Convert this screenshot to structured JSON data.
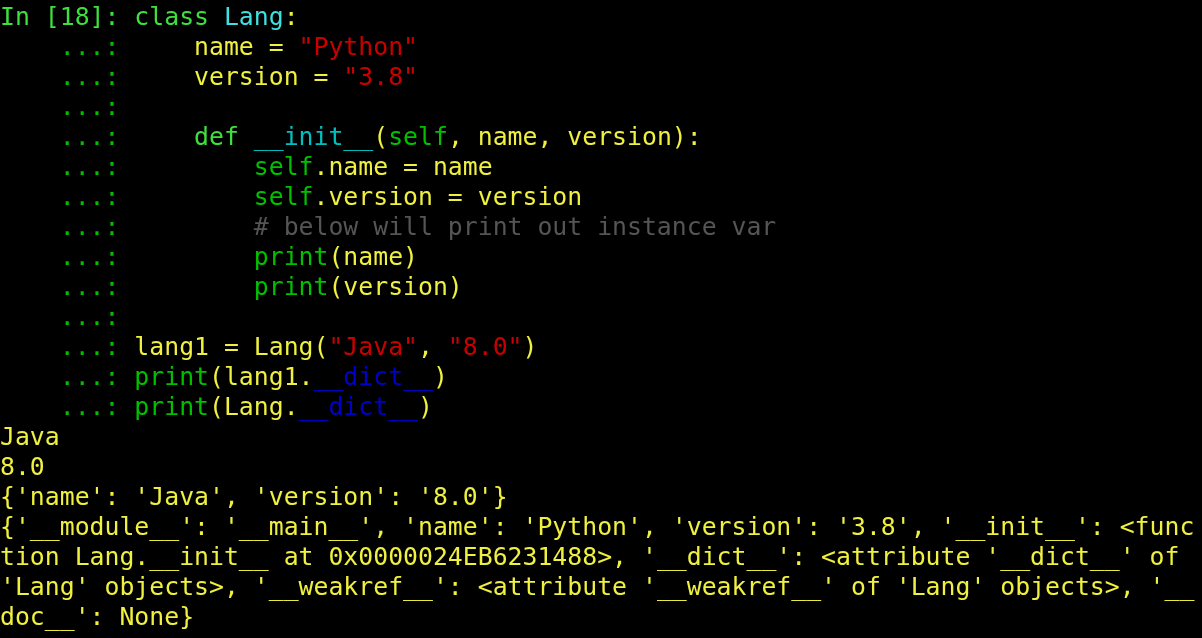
{
  "terminal": {
    "lines": [
      {
        "prompt": {
          "kind": "in",
          "text": "In [18]:"
        },
        "tokens": [
          {
            "kind": "keyword",
            "text": "class"
          },
          {
            "kind": "classname",
            "text": " Lang"
          },
          {
            "kind": "plain",
            "text": ":"
          }
        ]
      },
      {
        "prompt": {
          "kind": "cont",
          "text": "...:"
        },
        "tokens": [
          {
            "kind": "plain",
            "text": "    name = "
          },
          {
            "kind": "string",
            "text": "\"Python\""
          }
        ]
      },
      {
        "prompt": {
          "kind": "cont",
          "text": "...:"
        },
        "tokens": [
          {
            "kind": "plain",
            "text": "    version = "
          },
          {
            "kind": "string",
            "text": "\"3.8\""
          }
        ]
      },
      {
        "prompt": {
          "kind": "cont",
          "text": "...:"
        }
      },
      {
        "prompt": {
          "kind": "cont",
          "text": "...:"
        },
        "tokens": [
          {
            "kind": "keyword",
            "text": "    def"
          },
          {
            "kind": "function",
            "text": " __init__"
          },
          {
            "kind": "plain",
            "text": "("
          },
          {
            "kind": "builtin",
            "text": "self"
          },
          {
            "kind": "plain",
            "text": ", name, version):"
          }
        ]
      },
      {
        "prompt": {
          "kind": "cont",
          "text": "...:"
        },
        "tokens": [
          {
            "kind": "builtin",
            "text": "        self"
          },
          {
            "kind": "plain",
            "text": ".name = name"
          }
        ]
      },
      {
        "prompt": {
          "kind": "cont",
          "text": "...:"
        },
        "tokens": [
          {
            "kind": "builtin",
            "text": "        self"
          },
          {
            "kind": "plain",
            "text": ".version = version"
          }
        ]
      },
      {
        "prompt": {
          "kind": "cont",
          "text": "...:"
        },
        "tokens": [
          {
            "kind": "comment",
            "text": "        # below will print out instance var"
          }
        ]
      },
      {
        "prompt": {
          "kind": "cont",
          "text": "...:"
        },
        "tokens": [
          {
            "kind": "builtin",
            "text": "        print"
          },
          {
            "kind": "plain",
            "text": "(name)"
          }
        ]
      },
      {
        "prompt": {
          "kind": "cont",
          "text": "...:"
        },
        "tokens": [
          {
            "kind": "builtin",
            "text": "        print"
          },
          {
            "kind": "plain",
            "text": "(version)"
          }
        ]
      },
      {
        "prompt": {
          "kind": "cont",
          "text": "...:"
        }
      },
      {
        "prompt": {
          "kind": "cont",
          "text": "...:"
        },
        "tokens": [
          {
            "kind": "plain",
            "text": "lang1 = Lang("
          },
          {
            "kind": "string",
            "text": "\"Java\""
          },
          {
            "kind": "plain",
            "text": ", "
          },
          {
            "kind": "string",
            "text": "\"8.0\""
          },
          {
            "kind": "plain",
            "text": ")"
          }
        ]
      },
      {
        "prompt": {
          "kind": "cont",
          "text": "...:"
        },
        "tokens": [
          {
            "kind": "builtin",
            "text": "print"
          },
          {
            "kind": "plain",
            "text": "(lang1."
          },
          {
            "kind": "dunder",
            "text": "__dict__"
          },
          {
            "kind": "plain",
            "text": ")"
          }
        ]
      },
      {
        "prompt": {
          "kind": "cont",
          "text": "...:"
        },
        "tokens": [
          {
            "kind": "builtin",
            "text": "print"
          },
          {
            "kind": "plain",
            "text": "(Lang."
          },
          {
            "kind": "dunder",
            "text": "__dict__"
          },
          {
            "kind": "plain",
            "text": ")"
          }
        ]
      }
    ],
    "output": [
      "Java",
      "8.0",
      "{'name': 'Java', 'version': '8.0'}",
      "{'__module__': '__main__', 'name': 'Python', 'version': '3.8', '__init__': <func",
      "tion Lang.__init__ at 0x0000024EB6231488>, '__dict__': <attribute '__dict__' of",
      "'Lang' objects>, '__weakref__': <attribute '__weakref__' of 'Lang' objects>, '__",
      "doc__': None}"
    ]
  }
}
